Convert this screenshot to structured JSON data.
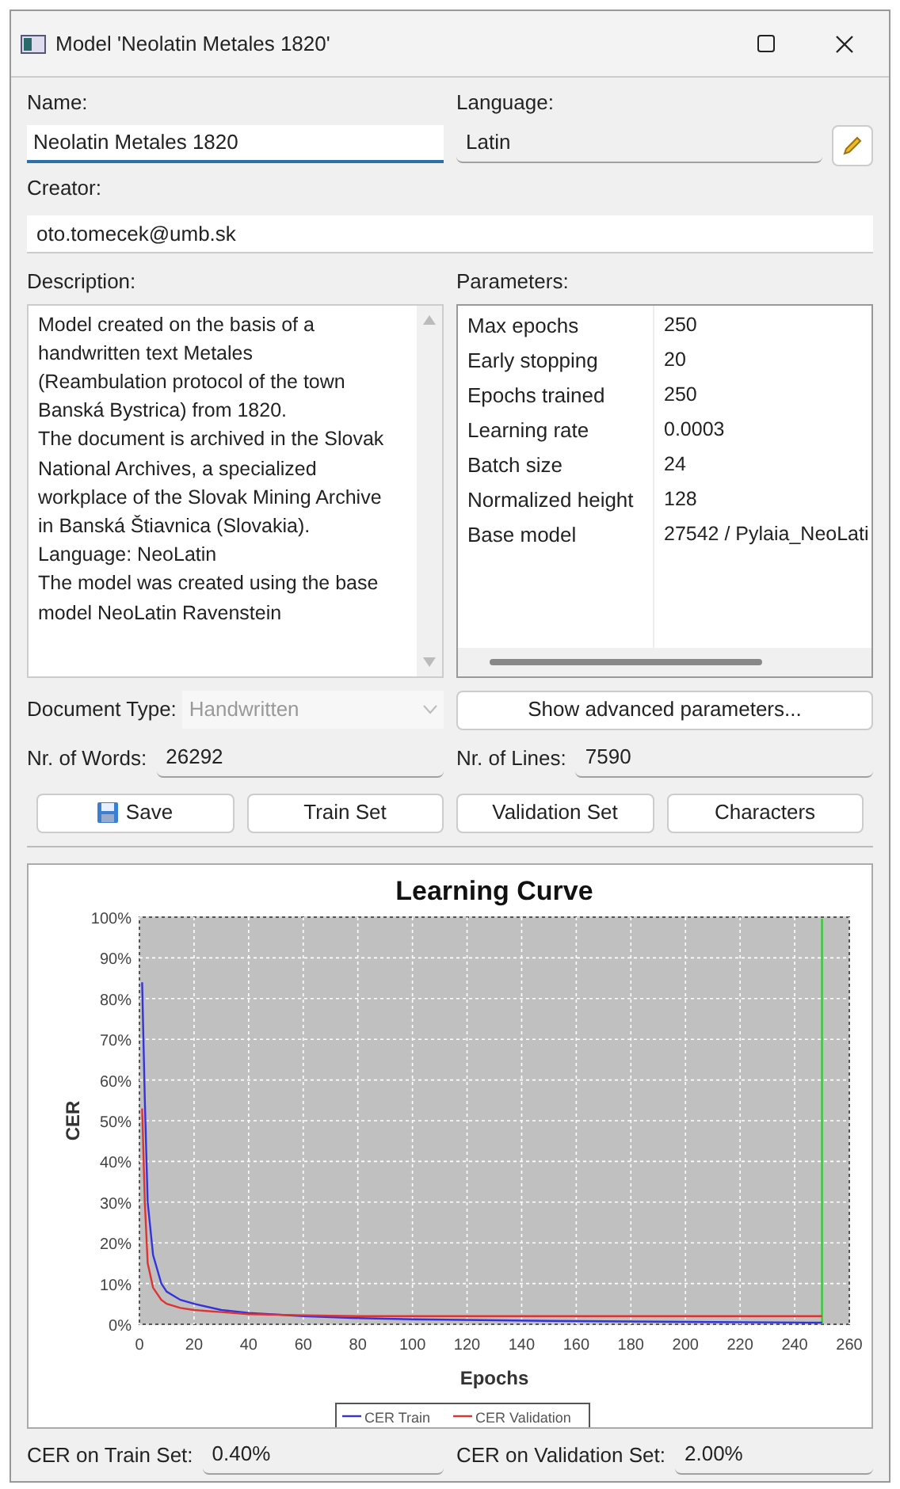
{
  "window": {
    "title": "Model 'Neolatin Metales 1820'"
  },
  "name": {
    "label": "Name:",
    "value": "Neolatin Metales 1820"
  },
  "language": {
    "label": "Language:",
    "value": "Latin"
  },
  "creator": {
    "label": "Creator:",
    "value": "oto.tomecek@umb.sk"
  },
  "description": {
    "label": "Description:",
    "lines": [
      "Model created on the basis of a",
      "handwritten text Metales",
      "(Reambulation protocol of the town",
      "Banská Bystrica) from 1820.",
      "The document is archived in the Slovak",
      "National Archives, a specialized",
      "workplace of the Slovak Mining Archive",
      "in Banská Štiavnica (Slovakia).",
      "Language: NeoLatin",
      "The model was created using the base",
      "model NeoLatin Ravenstein"
    ]
  },
  "parameters": {
    "label": "Parameters:",
    "rows": [
      {
        "name": "Max epochs",
        "value": "250"
      },
      {
        "name": "Early stopping",
        "value": "20"
      },
      {
        "name": "Epochs trained",
        "value": "250"
      },
      {
        "name": "Learning rate",
        "value": "0.0003"
      },
      {
        "name": "Batch size",
        "value": "24"
      },
      {
        "name": "Normalized height",
        "value": "128"
      },
      {
        "name": "Base model",
        "value": "27542 / Pylaia_NeoLati"
      }
    ]
  },
  "document_type": {
    "label": "Document Type:",
    "value": "Handwritten",
    "disabled": true
  },
  "advanced_button": "Show advanced parameters...",
  "words": {
    "label": "Nr. of Words:",
    "value": "26292"
  },
  "lines": {
    "label": "Nr. of Lines:",
    "value": "7590"
  },
  "buttons": [
    {
      "label": "Save",
      "kind": "save"
    },
    {
      "label": "Train Set",
      "kind": "plain"
    },
    {
      "label": "Validation Set",
      "kind": "plain"
    },
    {
      "label": "Characters",
      "kind": "plain"
    }
  ],
  "chart": {
    "chart_data": {
      "type": "line",
      "title": "Learning Curve",
      "xlabel": "Epochs",
      "ylabel": "CER",
      "x": [
        1,
        2,
        3,
        5,
        8,
        10,
        15,
        20,
        30,
        40,
        60,
        80,
        100,
        150,
        200,
        250
      ],
      "series": [
        {
          "name": "CER Train",
          "color": "#3333dd",
          "values": [
            0.84,
            0.55,
            0.3,
            0.17,
            0.1,
            0.08,
            0.06,
            0.05,
            0.035,
            0.028,
            0.02,
            0.015,
            0.012,
            0.008,
            0.006,
            0.004
          ]
        },
        {
          "name": "CER Validation",
          "color": "#dd3333",
          "values": [
            0.53,
            0.3,
            0.15,
            0.09,
            0.06,
            0.05,
            0.04,
            0.035,
            0.03,
            0.025,
            0.022,
            0.02,
            0.02,
            0.02,
            0.02,
            0.02
          ]
        }
      ],
      "xlim": [
        0,
        260
      ],
      "ylim": [
        0,
        1
      ],
      "xticks": [
        0,
        20,
        40,
        60,
        80,
        100,
        120,
        140,
        160,
        180,
        200,
        220,
        240,
        260
      ],
      "yticks": [
        {
          "value": 0,
          "label": "0%"
        },
        {
          "value": 0.1,
          "label": "10%"
        },
        {
          "value": 0.2,
          "label": "20%"
        },
        {
          "value": 0.3,
          "label": "30%"
        },
        {
          "value": 0.4,
          "label": "40%"
        },
        {
          "value": 0.5,
          "label": "50%"
        },
        {
          "value": 0.6,
          "label": "60%"
        },
        {
          "value": 0.7,
          "label": "70%"
        },
        {
          "value": 0.8,
          "label": "80%"
        },
        {
          "value": 0.9,
          "label": "90%"
        },
        {
          "value": 1,
          "label": "100%"
        }
      ],
      "ref_lines": [
        {
          "axis": "x",
          "value": 250,
          "color": "#33cc33"
        }
      ],
      "grid": true,
      "legend": true
    }
  },
  "cer_train": {
    "label": "CER on Train Set:",
    "value": "0.40%"
  },
  "cer_validation": {
    "label": "CER on Validation Set:",
    "value": "2.00%"
  }
}
